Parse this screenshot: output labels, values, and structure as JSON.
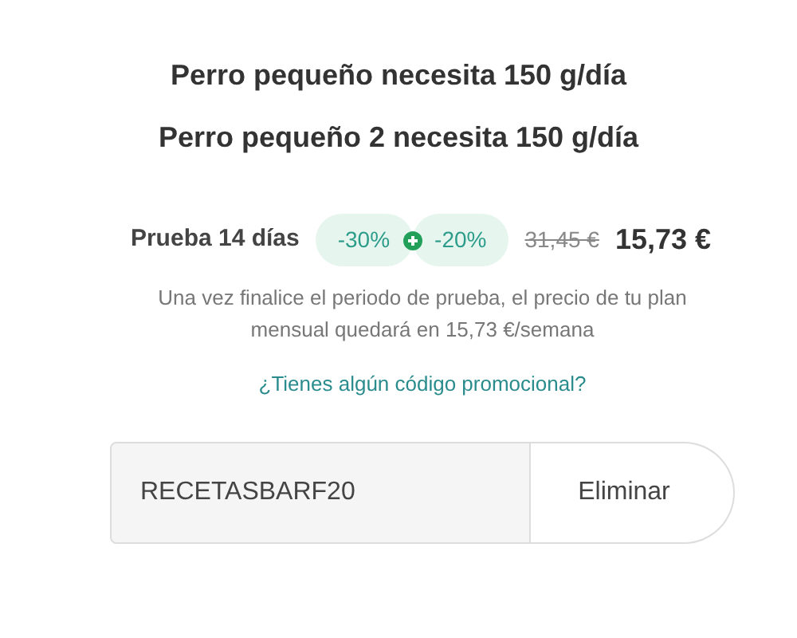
{
  "needs": [
    "Perro pequeño necesita 150 g/día",
    "Perro pequeño 2 necesita 150 g/día"
  ],
  "trial": {
    "label": "Prueba 14 días",
    "discounts": [
      "-30%",
      "-20%"
    ],
    "old_price": "31,45 €",
    "price": "15,73 €"
  },
  "note": "Una vez finalice el periodo de prueba, el precio de tu plan mensual quedará en 15,73 €/semana",
  "promo_link": "¿Tienes algún código promocional?",
  "promo": {
    "value": "RECETASBARF20",
    "button": "Eliminar"
  }
}
